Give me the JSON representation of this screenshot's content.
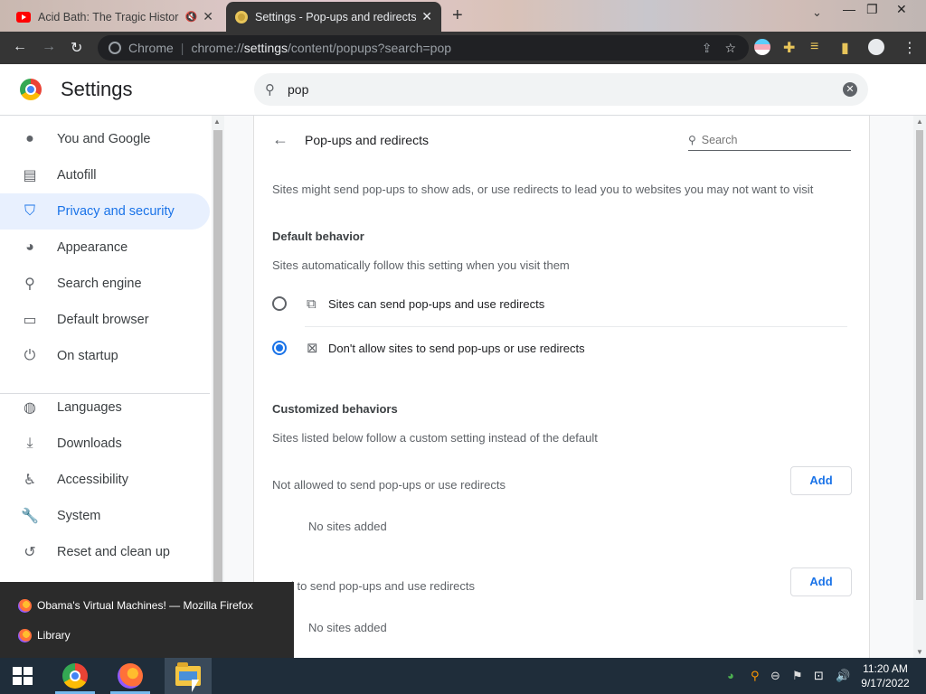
{
  "tabs": [
    {
      "title": "Acid Bath: The Tragic Histor",
      "icon": "youtube-icon",
      "audio": "🔇"
    },
    {
      "title": "Settings - Pop-ups and redirects",
      "icon": "settings-gear-icon"
    }
  ],
  "omnibox": {
    "site_label": "Chrome",
    "url_prefix": "chrome://",
    "url_host": "settings",
    "url_path": "/content/popups?search=pop"
  },
  "header": {
    "title": "Settings",
    "search_value": "pop"
  },
  "sidebar": {
    "items": [
      {
        "label": "You and Google",
        "icon": "person-icon"
      },
      {
        "label": "Autofill",
        "icon": "clipboard-icon"
      },
      {
        "label": "Privacy and security",
        "icon": "shield-icon",
        "active": true
      },
      {
        "label": "Appearance",
        "icon": "palette-icon"
      },
      {
        "label": "Search engine",
        "icon": "search-icon"
      },
      {
        "label": "Default browser",
        "icon": "browser-icon"
      },
      {
        "label": "On startup",
        "icon": "power-icon"
      },
      {
        "label": "Languages",
        "icon": "globe-icon"
      },
      {
        "label": "Downloads",
        "icon": "download-icon"
      },
      {
        "label": "Accessibility",
        "icon": "accessibility-icon"
      },
      {
        "label": "System",
        "icon": "wrench-icon"
      },
      {
        "label": "Reset and clean up",
        "icon": "history-icon"
      }
    ]
  },
  "main": {
    "title": "Pop-ups and redirects",
    "search_placeholder": "Search",
    "description": "Sites might send pop-ups to show ads, or use redirects to lead you to websites you may not want to visit",
    "default_behavior": {
      "heading": "Default behavior",
      "subtext": "Sites automatically follow this setting when you visit them",
      "options": [
        {
          "label": "Sites can send pop-ups and use redirects",
          "icon": "open-in-new-icon",
          "checked": false
        },
        {
          "label": "Don't allow sites to send pop-ups or use redirects",
          "icon": "popup-blocked-icon",
          "checked": true
        }
      ]
    },
    "customized": {
      "heading": "Customized behaviors",
      "subtext": "Sites listed below follow a custom setting instead of the default",
      "not_allowed_label": "Not allowed to send pop-ups or use redirects",
      "allowed_label": "wed to send pop-ups and use redirects",
      "add_label": "Add",
      "empty_label": "No sites added"
    }
  },
  "jumplist": {
    "items": [
      {
        "label": "Obama's Virtual Machines! — Mozilla Firefox"
      },
      {
        "label": "Library"
      }
    ]
  },
  "taskbar": {
    "time": "11:20 AM",
    "date": "9/17/2022"
  },
  "colors": {
    "accent": "#1a73e8",
    "active_nav_bg": "#e8f0fe",
    "toolbar_bg": "#353535",
    "taskbar_bg": "#1f2d3a"
  }
}
